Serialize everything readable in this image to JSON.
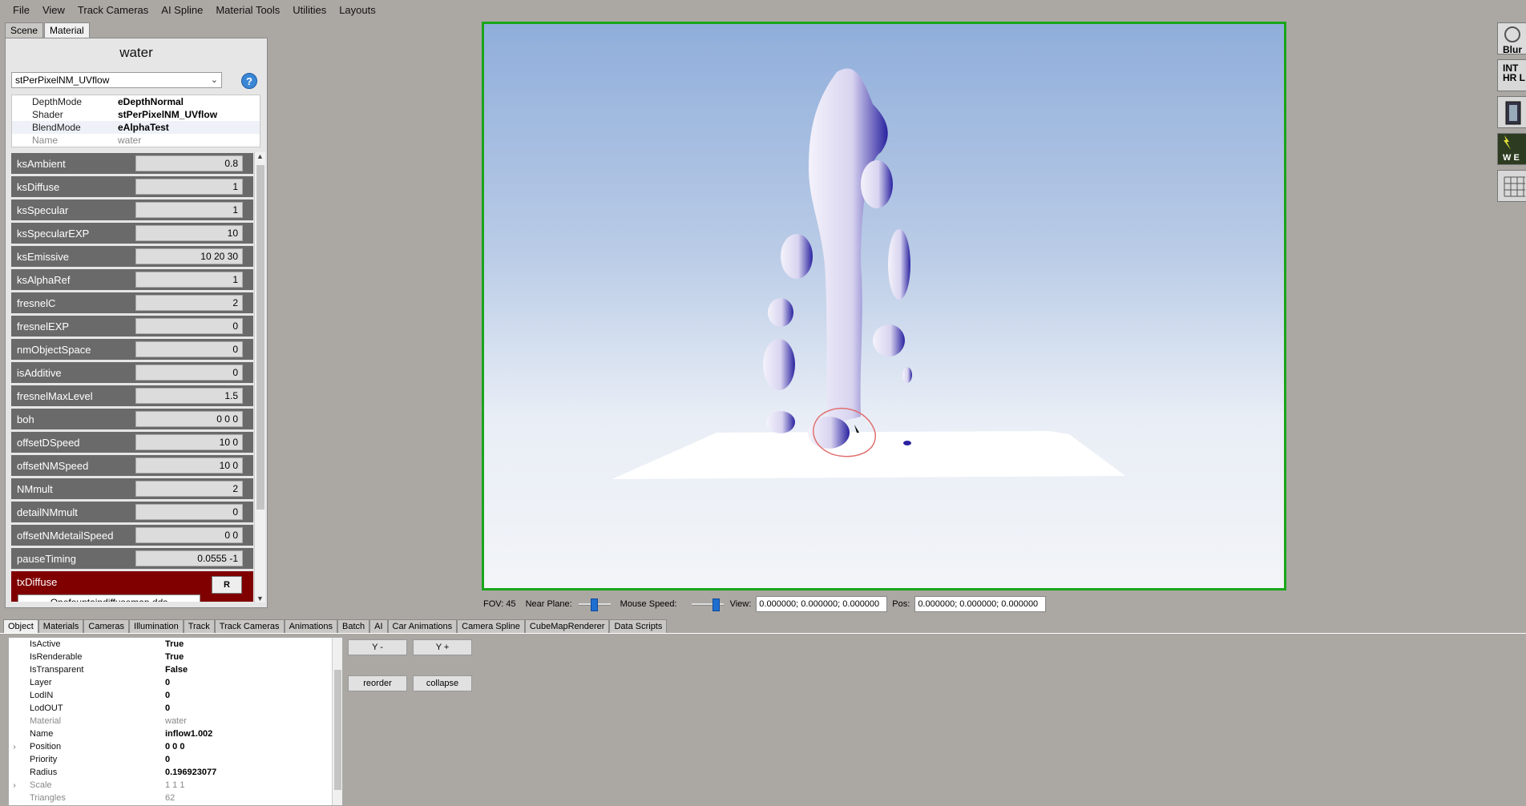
{
  "menu": [
    "File",
    "View",
    "Track Cameras",
    "AI Spline",
    "Material Tools",
    "Utilities",
    "Layouts"
  ],
  "left_tabs": [
    "Scene",
    "Material"
  ],
  "material": {
    "title": "water",
    "shader_select": "stPerPixelNM_UVflow",
    "help": "?",
    "properties": [
      {
        "key": "DepthMode",
        "value": "eDepthNormal"
      },
      {
        "key": "Shader",
        "value": "stPerPixelNM_UVflow"
      },
      {
        "key": "BlendMode",
        "value": "eAlphaTest"
      },
      {
        "key": "Name",
        "value": "water"
      }
    ],
    "params": [
      {
        "name": "ksAmbient",
        "value": "0.8"
      },
      {
        "name": "ksDiffuse",
        "value": "1"
      },
      {
        "name": "ksSpecular",
        "value": "1"
      },
      {
        "name": "ksSpecularEXP",
        "value": "10"
      },
      {
        "name": "ksEmissive",
        "value": "10 20 30"
      },
      {
        "name": "ksAlphaRef",
        "value": "1"
      },
      {
        "name": "fresnelC",
        "value": "2"
      },
      {
        "name": "fresnelEXP",
        "value": "0"
      },
      {
        "name": "nmObjectSpace",
        "value": "0"
      },
      {
        "name": "isAdditive",
        "value": "0"
      },
      {
        "name": "fresnelMaxLevel",
        "value": "1.5"
      },
      {
        "name": "boh",
        "value": "0 0 0"
      },
      {
        "name": "offsetDSpeed",
        "value": "10 0"
      },
      {
        "name": "offsetNMSpeed",
        "value": "10 0"
      },
      {
        "name": "NMmult",
        "value": "2"
      },
      {
        "name": "detailNMmult",
        "value": "0"
      },
      {
        "name": "offsetNMdetailSpeed",
        "value": "0 0"
      },
      {
        "name": "pauseTiming",
        "value": "0.0555 -1"
      }
    ],
    "texture": {
      "name": "txDiffuse",
      "button": "R",
      "file": "Onefountaindiffusemap.dds"
    }
  },
  "viewport_controls": {
    "fov": "FOV: 45",
    "near_plane_label": "Near Plane:",
    "near_plane_value": 0.5,
    "mouse_speed_label": "Mouse Speed:",
    "mouse_speed_value": 0.85,
    "view_label": "View:",
    "view_value": "0.000000; 0.000000; 0.000000",
    "pos_label": "Pos:",
    "pos_value": "0.000000; 0.000000; 0.000000"
  },
  "right_toolbar": [
    "Blur",
    "INT HR L",
    "",
    "W E",
    ""
  ],
  "bottom_tabs": [
    "Object",
    "Materials",
    "Cameras",
    "Illumination",
    "Track",
    "Track Cameras",
    "Animations",
    "Batch",
    "AI",
    "Car Animations",
    "Camera Spline",
    "CubeMapRenderer",
    "Data Scripts"
  ],
  "object": {
    "rows": [
      {
        "key": "IsActive",
        "value": "True",
        "dim": false,
        "expand": false
      },
      {
        "key": "IsRenderable",
        "value": "True",
        "dim": false,
        "expand": false
      },
      {
        "key": "IsTransparent",
        "value": "False",
        "dim": false,
        "expand": false
      },
      {
        "key": "Layer",
        "value": "0",
        "dim": false,
        "expand": false
      },
      {
        "key": "LodIN",
        "value": "0",
        "dim": false,
        "expand": false
      },
      {
        "key": "LodOUT",
        "value": "0",
        "dim": false,
        "expand": false
      },
      {
        "key": "Material",
        "value": "water",
        "dim": true,
        "expand": false
      },
      {
        "key": "Name",
        "value": "inflow1.002",
        "dim": false,
        "expand": false
      },
      {
        "key": "Position",
        "value": "0 0 0",
        "dim": false,
        "expand": true
      },
      {
        "key": "Priority",
        "value": "0",
        "dim": false,
        "expand": false
      },
      {
        "key": "Radius",
        "value": "0.196923077",
        "dim": false,
        "expand": false
      },
      {
        "key": "Scale",
        "value": "1 1 1",
        "dim": true,
        "expand": true
      },
      {
        "key": "Triangles",
        "value": "62",
        "dim": true,
        "expand": false
      }
    ]
  },
  "side_buttons": {
    "y_minus": "Y -",
    "y_plus": "Y +",
    "reorder": "reorder",
    "collapse": "collapse"
  },
  "colors": {
    "viewport_border": "#1aa51a",
    "texture_row": "#800000",
    "param_label_bg": "#6a6a6a"
  }
}
